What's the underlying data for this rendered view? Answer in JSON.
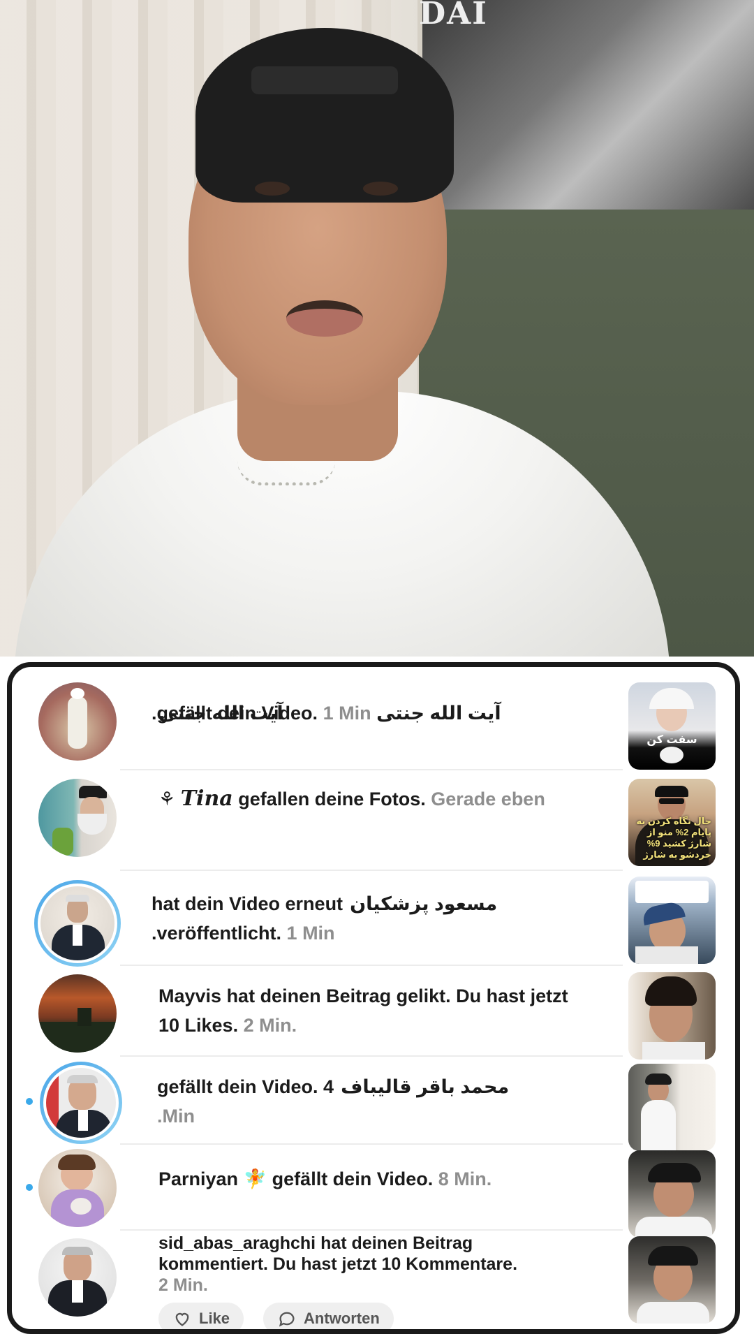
{
  "notifications": [
    {
      "name": "ayatollah-jannati",
      "prefix": "",
      "user": "آيت الله جنتی",
      "action": ".gefällt dein Video.",
      "time": "1 Min",
      "unread": false,
      "ring": false
    },
    {
      "name": "tina",
      "prefix": "⚘ ",
      "user": "Tina",
      "action": " gefallen deine Fotos. ",
      "time": "Gerade eben",
      "unread": false,
      "ring": false,
      "thumb_caption": "حال نگاه کردن به پایام 2% منو از شارژ کشید 9% خردشو به شارژ"
    },
    {
      "name": "masoud-pezeshkian",
      "user": "مسعود پزشکیان",
      "action": "hat dein Video erneut .veröffentlicht.",
      "time": "1 Min",
      "unread": false,
      "ring": true
    },
    {
      "name": "mayvis",
      "user": "Mayvis",
      "action": " hat deinen Beitrag gelikt. Du hast jetzt 10 Likes. ",
      "time": "2 Min.",
      "unread": false,
      "ring": false
    },
    {
      "name": "mohammad-bagher-ghalibaf",
      "user": "محمد باقر قالیباف",
      "action": "gefällt dein Video. 4",
      "time": ".Min",
      "unread": true,
      "ring": true
    },
    {
      "name": "parniyan",
      "user": "Parniyan 🧚",
      "action": " gefällt dein Video. ",
      "time": "8 Min.",
      "unread": true,
      "ring": false
    },
    {
      "name": "sid-abas-araghchi",
      "user": "sid_abas_araghchi",
      "action": " hat deinen Beitrag kommentiert. Du hast jetzt 10 Kommentare. ",
      "time": "2 Min.",
      "unread": false,
      "ring": false
    }
  ],
  "first_thumb_caption": "سفت کن",
  "actions": {
    "like_label": "Like",
    "reply_label": "Antworten"
  },
  "colors": {
    "accent": "#3aa9ea",
    "text": "#1b1b1b",
    "muted": "#8e8e8e"
  },
  "poster_text": "DAI"
}
